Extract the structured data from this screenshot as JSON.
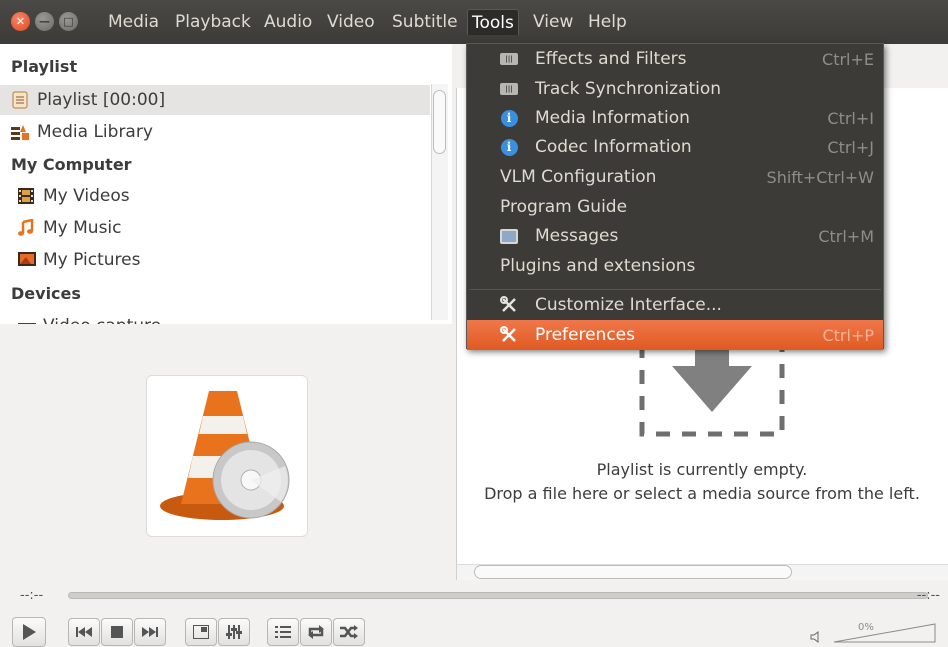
{
  "menubar": {
    "items": [
      "Media",
      "Playback",
      "Audio",
      "Video",
      "Subtitle",
      "Tools",
      "View",
      "Help"
    ],
    "open_menu": "Tools"
  },
  "sidebar": {
    "header_playlist": "Playlist",
    "items_playlist": [
      {
        "label": "Playlist [00:00]",
        "icon": "playlist-icon",
        "selected": true
      },
      {
        "label": "Media Library",
        "icon": "media-library-icon",
        "selected": false
      }
    ],
    "header_my_computer": "My Computer",
    "items_my_computer": [
      {
        "label": "My Videos",
        "icon": "film-icon"
      },
      {
        "label": "My Music",
        "icon": "music-note-icon"
      },
      {
        "label": "My Pictures",
        "icon": "picture-icon"
      }
    ],
    "header_devices": "Devices",
    "items_devices": [
      {
        "label": "Video capture",
        "icon": "capture-icon"
      }
    ]
  },
  "tools_menu": {
    "items": [
      {
        "label": "Effects and Filters",
        "shortcut": "Ctrl+E",
        "icon": "equalizer-icon"
      },
      {
        "label": "Track Synchronization",
        "shortcut": "",
        "icon": "equalizer-icon"
      },
      {
        "label": "Media Information",
        "shortcut": "Ctrl+I",
        "icon": "info-icon"
      },
      {
        "label": "Codec Information",
        "shortcut": "Ctrl+J",
        "icon": "info-icon"
      },
      {
        "label": "VLM Configuration",
        "shortcut": "Shift+Ctrl+W",
        "icon": ""
      },
      {
        "label": "Program Guide",
        "shortcut": "",
        "icon": ""
      },
      {
        "label": "Messages",
        "shortcut": "Ctrl+M",
        "icon": "terminal-icon"
      },
      {
        "label": "Plugins and extensions",
        "shortcut": "",
        "icon": ""
      },
      {
        "label": "Customize Interface...",
        "shortcut": "",
        "icon": "tools-icon"
      },
      {
        "label": "Preferences",
        "shortcut": "Ctrl+P",
        "icon": "tools-icon",
        "highlighted": true
      }
    ]
  },
  "playlist": {
    "empty_line1": "Playlist is currently empty.",
    "empty_line2": "Drop a file here or select a media source from the left."
  },
  "controls": {
    "time_elapsed": "--:--",
    "time_total": "--:--",
    "volume_percent": "0%",
    "volume_level": 0
  },
  "colors": {
    "menubar_bg": "#3c3b37",
    "highlight": "#e9622b",
    "info_icon": "#3b8fe0",
    "cone_orange": "#e8731c"
  }
}
